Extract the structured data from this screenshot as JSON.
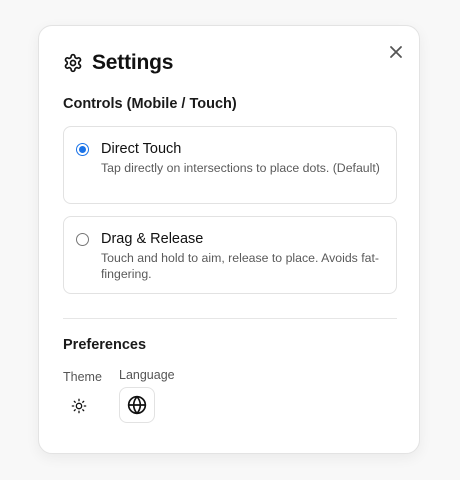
{
  "dialog": {
    "title": "Settings",
    "title_icon": "gear-icon",
    "close_icon": "close-icon"
  },
  "controls": {
    "heading": "Controls (Mobile / Touch)",
    "options": [
      {
        "label": "Direct Touch",
        "description": "Tap directly on intersections to place dots. (Default)",
        "selected": true
      },
      {
        "label": "Drag & Release",
        "description": "Touch and hold to aim, release to place. Avoids fat-fingering.",
        "selected": false
      }
    ]
  },
  "preferences": {
    "heading": "Preferences",
    "theme_label": "Theme",
    "theme_icon": "sun-icon",
    "language_label": "Language",
    "language_icon": "globe-icon"
  },
  "colors": {
    "accent": "#1a73e8",
    "text": "#111111",
    "muted": "#5a5a5a",
    "border": "#e2e2e2"
  }
}
